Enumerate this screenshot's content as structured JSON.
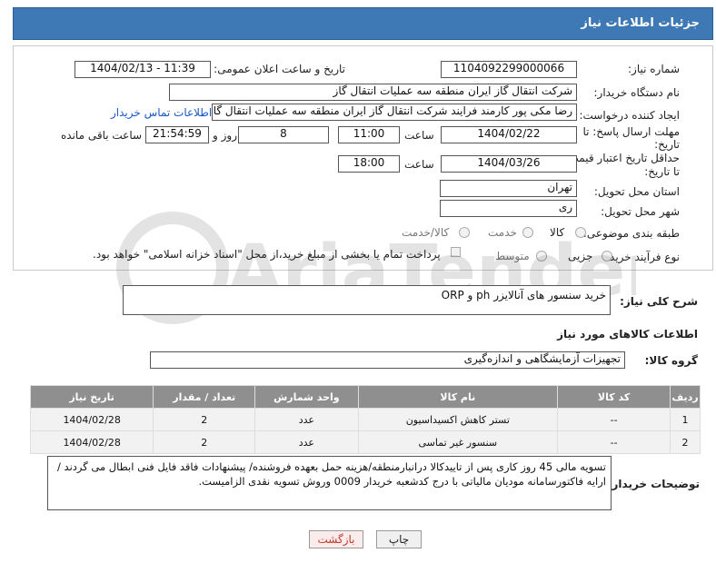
{
  "header": {
    "title": "جزئیات اطلاعات نیاز"
  },
  "form": {
    "need_no_label": "شماره نیاز:",
    "need_no": "1104092299000066",
    "announce_label": "تاریخ و ساعت اعلان عمومی:",
    "announce_value": "1404/02/13 - 11:39",
    "buyer_org_label": "نام دستگاه خریدار:",
    "buyer_org": "شرکت انتقال گاز ایران منطقه سه عملیات انتقال گاز",
    "creator_label": "ایجاد کننده درخواست:",
    "creator": "رضا مکی پور کارمند فرایند شرکت انتقال گاز ایران منطقه سه عملیات انتقال گاز",
    "contact_link": "اطلاعات تماس خریدار",
    "deadline_label_1": "مهلت ارسال پاسخ: تا",
    "deadline_label_2": "تاریخ:",
    "deadline_date": "1404/02/22",
    "time_label": "ساعت",
    "deadline_time": "11:00",
    "days": "8",
    "days_label": "روز و",
    "remaining": "21:54:59",
    "remaining_label": "ساعت باقی مانده",
    "price_label_1": "حداقل تاریخ اعتبار قیمت:",
    "price_label_2": "تا تاریخ:",
    "price_date": "1404/03/26",
    "price_time": "18:00",
    "province_label": "استان محل تحویل:",
    "province": "تهران",
    "city_label": "شهر محل تحویل:",
    "city": "ری",
    "category_label": "طبقه بندی موضوعی:",
    "cat_goods": "کالا",
    "cat_service": "خدمت",
    "cat_goods_service": "کالا/خدمت",
    "process_label": "نوع فرآیند خرید :",
    "proc_small": "جزیی",
    "proc_medium": "متوسط",
    "payment_note": "پرداخت تمام یا بخشی از مبلغ خرید،از محل \"اسناد خزانه اسلامی\" خواهد بود."
  },
  "summary": {
    "label": "شرح کلی نیاز:",
    "value": "خرید سنسور های آنالایزر ph و ORP"
  },
  "goods_info": {
    "title": "اطلاعات کالاهای مورد نیاز",
    "group_label": "گروه کالا:",
    "group_value": "تجهیزات آزمایشگاهی و اندازه‌گیری"
  },
  "table": {
    "headers": [
      "ردیف",
      "کد کالا",
      "نام کالا",
      "واحد شمارش",
      "تعداد / مقدار",
      "تاریخ نیاز"
    ],
    "rows": [
      [
        "1",
        "--",
        "تستر کاهش اکسیداسیون",
        "عدد",
        "2",
        "1404/02/28"
      ],
      [
        "2",
        "--",
        "سنسور غیر تماسی",
        "عدد",
        "2",
        "1404/02/28"
      ]
    ]
  },
  "notes": {
    "label": "توضیحات خریدار:",
    "text": "تسویه مالی 45 روز کاری پس از تاییدکالا درانبارمنطقه/هزینه حمل بعهده فروشنده/ پیشنهادات فاقد فایل فنی ابطال می گردند  /ارایه فاکتورسامانه مودیان مالیاتی با درج کدشعبه خریدار 0009 وروش تسویه نقدی الزامیست."
  },
  "buttons": {
    "print": "چاپ",
    "back": "بازگشت"
  },
  "watermark": {
    "text": "AriaTender.net"
  }
}
